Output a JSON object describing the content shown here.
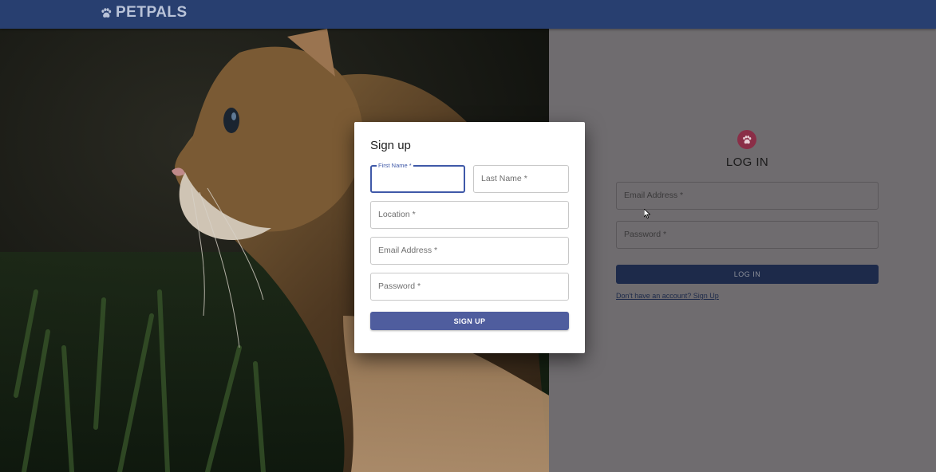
{
  "appbar": {
    "brand": "PETPALS",
    "brand_icon": "paw-icon",
    "background_color": "#283f70"
  },
  "hero": {
    "image": "cat-in-grass-photo"
  },
  "login": {
    "icon": "paw-icon",
    "title": "LOG IN",
    "email_label": "Email Address *",
    "password_label": "Password *",
    "button_label": "LOG IN",
    "signup_link": "Don't have an account? Sign Up"
  },
  "signup_modal": {
    "title": "Sign up",
    "first_name_label": "First Name *",
    "last_name_label": "Last Name *",
    "location_label": "Location *",
    "email_label": "Email Address *",
    "password_label": "Password *",
    "button_label": "SIGN UP",
    "accent_color": "#3f59a8"
  }
}
